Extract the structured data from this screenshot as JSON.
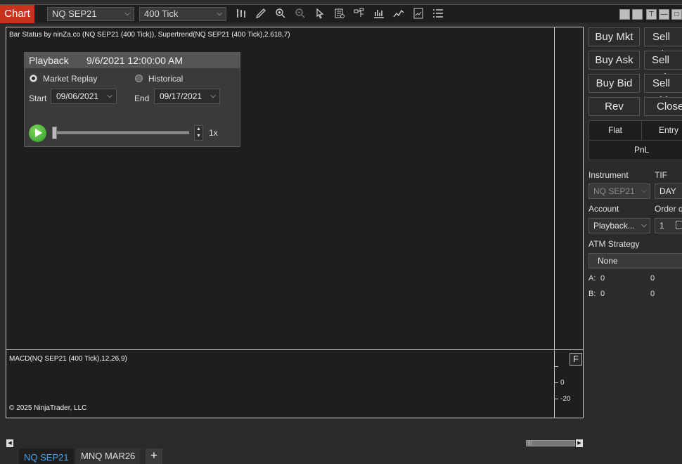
{
  "toolbar": {
    "chart_tab": "Chart",
    "instrument": "NQ SEP21",
    "interval": "400 Tick",
    "icons": [
      "bar-style-icon",
      "drawing-tool-icon",
      "zoom-in-icon",
      "zoom-out-icon",
      "pointer-icon",
      "properties-icon",
      "strategies-icon",
      "indicators-icon",
      "data-series-icon",
      "templates-icon",
      "list-icon"
    ]
  },
  "chart": {
    "indicator_label": "Bar Status by ninZa.co (NQ SEP21 (400 Tick)), Supertrend(NQ SEP21 (400 Tick),2.618,7)",
    "macd_label": "MACD(NQ SEP21 (400 Tick),12,26,9)",
    "copyright": "© 2025 NinjaTrader, LLC",
    "f_button": "F",
    "axis_labels": [
      "0",
      "-20"
    ]
  },
  "playback": {
    "title": "Playback",
    "datetime": "9/6/2021 12:00:00 AM",
    "mode_market_replay": "Market Replay",
    "mode_historical": "Historical",
    "selected_mode": "Market Replay",
    "start_label": "Start",
    "start_date": "09/06/2021",
    "end_label": "End",
    "end_date": "09/17/2021",
    "speed": "1x",
    "progress": 0
  },
  "tabs": {
    "items": [
      "NQ SEP21",
      "MNQ MAR26"
    ],
    "active": "NQ SEP21",
    "add": "+"
  },
  "order_panel": {
    "buy_mkt": "Buy Mkt",
    "sell_mkt": "Sell Mkt",
    "buy_ask": "Buy Ask",
    "sell_ask": "Sell Ask",
    "buy_bid": "Buy Bid",
    "sell_bid": "Sell Bid",
    "rev": "Rev",
    "close": "Close",
    "flat": "Flat",
    "entry": "Entry",
    "pnl": "PnL",
    "instrument_label": "Instrument",
    "instrument_value": "NQ SEP21",
    "tif_label": "TIF",
    "tif_value": "DAY",
    "account_label": "Account",
    "account_value": "Playback...",
    "order_qty_label": "Order qty",
    "order_qty_value": "1",
    "atm_label": "ATM Strategy",
    "atm_value": "None",
    "a_label": "A:",
    "a_value": "0",
    "a_value2": "0",
    "b_label": "B:",
    "b_value": "0",
    "b_value2": "0"
  }
}
